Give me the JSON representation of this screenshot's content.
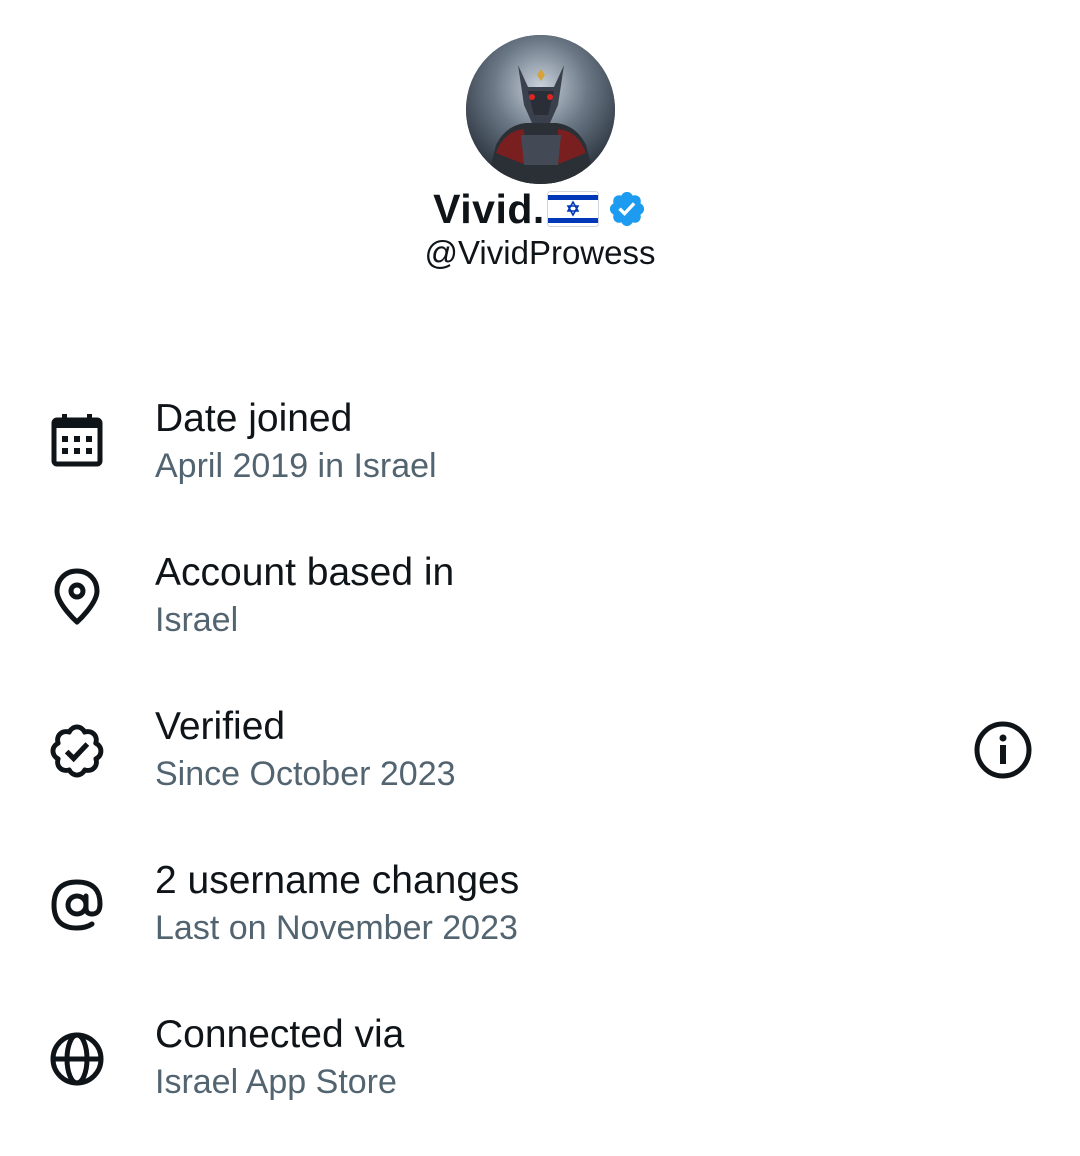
{
  "profile": {
    "display_name": "Vivid.",
    "handle": "@VividProwess",
    "flag_icon": "israel-flag-emoji",
    "verified_icon": "verified-badge-icon",
    "verified_color": "#1d9bf0"
  },
  "info": [
    {
      "icon": "calendar-icon",
      "title": "Date joined",
      "subtitle": "April 2019 in Israel"
    },
    {
      "icon": "location-pin-icon",
      "title": "Account based in",
      "subtitle": "Israel"
    },
    {
      "icon": "verified-outline-icon",
      "title": "Verified",
      "subtitle": "Since October 2023"
    },
    {
      "icon": "at-sign-icon",
      "title": "2 username changes",
      "subtitle": "Last on November 2023"
    },
    {
      "icon": "globe-icon",
      "title": "Connected via",
      "subtitle": "Israel App Store"
    }
  ],
  "colors": {
    "primary_text": "#0f1419",
    "secondary_text": "#536471",
    "background": "#ffffff"
  }
}
